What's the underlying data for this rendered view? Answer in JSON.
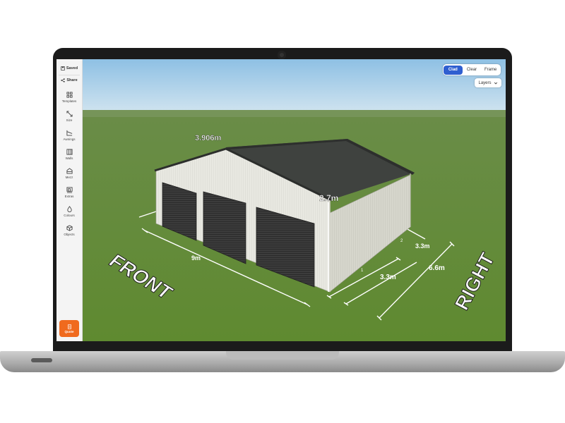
{
  "sidebar": {
    "saved_label": "Saved",
    "share_label": "Share",
    "items": [
      {
        "label": "Templates",
        "icon": "grid-icon"
      },
      {
        "label": "Size",
        "icon": "resize-arrows-icon"
      },
      {
        "label": "Awnings",
        "icon": "awning-icon"
      },
      {
        "label": "Walls",
        "icon": "walls-icon"
      },
      {
        "label": "Mezz",
        "icon": "mezzanine-icon"
      },
      {
        "label": "Extras",
        "icon": "extras-icon"
      },
      {
        "label": "Colours",
        "icon": "droplet-icon"
      },
      {
        "label": "Objects",
        "icon": "cube-icon"
      }
    ],
    "quote_label": "Quote"
  },
  "view_toggle": {
    "options": [
      "Clad",
      "Clear",
      "Frame"
    ],
    "selected": "Clad"
  },
  "layers_label": "Layers",
  "scene": {
    "dimensions": {
      "front_width": "9m",
      "apex_height": "3.906m",
      "wall_height": "2.7m",
      "side_length": "6.6m",
      "bay_1": "3.3m",
      "bay_2": "3.3m"
    },
    "bay_markers": [
      "1",
      "2"
    ],
    "side_labels": {
      "front": "FRONT",
      "right": "RIGHT"
    }
  },
  "colors": {
    "accent": "#2f5fd0",
    "quote": "#f06a1e",
    "roof": "#3d403d",
    "walls": "#e9e9e2",
    "doors": "#3a3a3a",
    "grass": "#6b8f3a",
    "sky": "#a9cfe9"
  }
}
